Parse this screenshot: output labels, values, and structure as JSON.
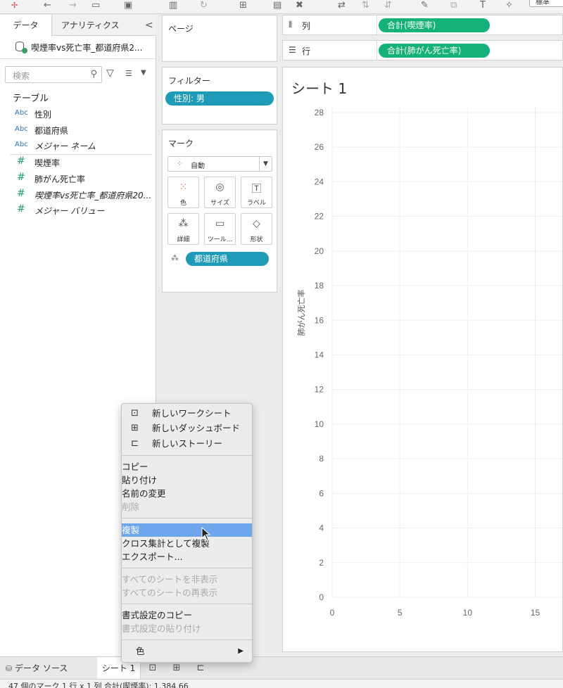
{
  "toolbar": {
    "standard_label": "標準"
  },
  "left": {
    "tab_data": "データ",
    "tab_analytics": "アナリティクス",
    "collapse": "<",
    "datasource": "喫煙率vs死亡率_都道府県2...",
    "search_placeholder": "検索",
    "tables_header": "テーブル",
    "dimensions": [
      {
        "type": "Abc",
        "name": "性別"
      },
      {
        "type": "Abc",
        "name": "都道府県"
      },
      {
        "type": "Abc",
        "name": "メジャー ネーム"
      }
    ],
    "measures": [
      {
        "type": "#",
        "name": "喫煙率"
      },
      {
        "type": "#",
        "name": "肺がん死亡率"
      },
      {
        "type": "#",
        "name": "喫煙率vs死亡率_都道府県20..."
      },
      {
        "type": "#",
        "name": "メジャー バリュー"
      }
    ]
  },
  "pages": {
    "title": "ページ"
  },
  "filters": {
    "title": "フィルター",
    "pill": "性別: 男"
  },
  "marks": {
    "title": "マーク",
    "type": "自動",
    "buttons": {
      "color": "色",
      "size": "サイズ",
      "label": "ラベル",
      "detail": "詳細",
      "tooltip": "ツール...",
      "shape": "形状"
    },
    "detail_pill": "都道府県"
  },
  "shelves": {
    "columns_label": "列",
    "columns_pill": "合計(喫煙率)",
    "rows_label": "行",
    "rows_pill": "合計(肺がん死亡率)"
  },
  "sheet": {
    "title": "シート 1"
  },
  "chart_data": {
    "type": "scatter",
    "ylabel": "肺がん死亡率",
    "xlabel": "",
    "y_ticks": [
      0,
      2,
      4,
      6,
      8,
      10,
      12,
      14,
      16,
      18,
      20,
      22,
      24,
      26,
      28
    ],
    "x_ticks": [
      0,
      5,
      10,
      15
    ],
    "ylim": [
      0,
      28
    ],
    "x_visible_range": [
      0,
      17
    ],
    "grid": true,
    "points": []
  },
  "tabs": {
    "datasource": "データ ソース",
    "sheet1": "シート 1"
  },
  "status": "47 個のマーク   1 行 x 1 列   合計(喫煙率): 1,384.66",
  "menu": {
    "new_worksheet": "新しいワークシート",
    "new_dashboard": "新しいダッシュボード",
    "new_story": "新しいストーリー",
    "copy": "コピー",
    "paste": "貼り付け",
    "rename": "名前の変更",
    "delete": "削除",
    "duplicate": "複製",
    "duplicate_crosstab": "クロス集計として複製",
    "export": "エクスポート...",
    "hide_all": "すべてのシートを非表示",
    "show_all": "すべてのシートの再表示",
    "copy_format": "書式設定のコピー",
    "paste_format": "書式設定の貼り付け",
    "color": "色"
  }
}
